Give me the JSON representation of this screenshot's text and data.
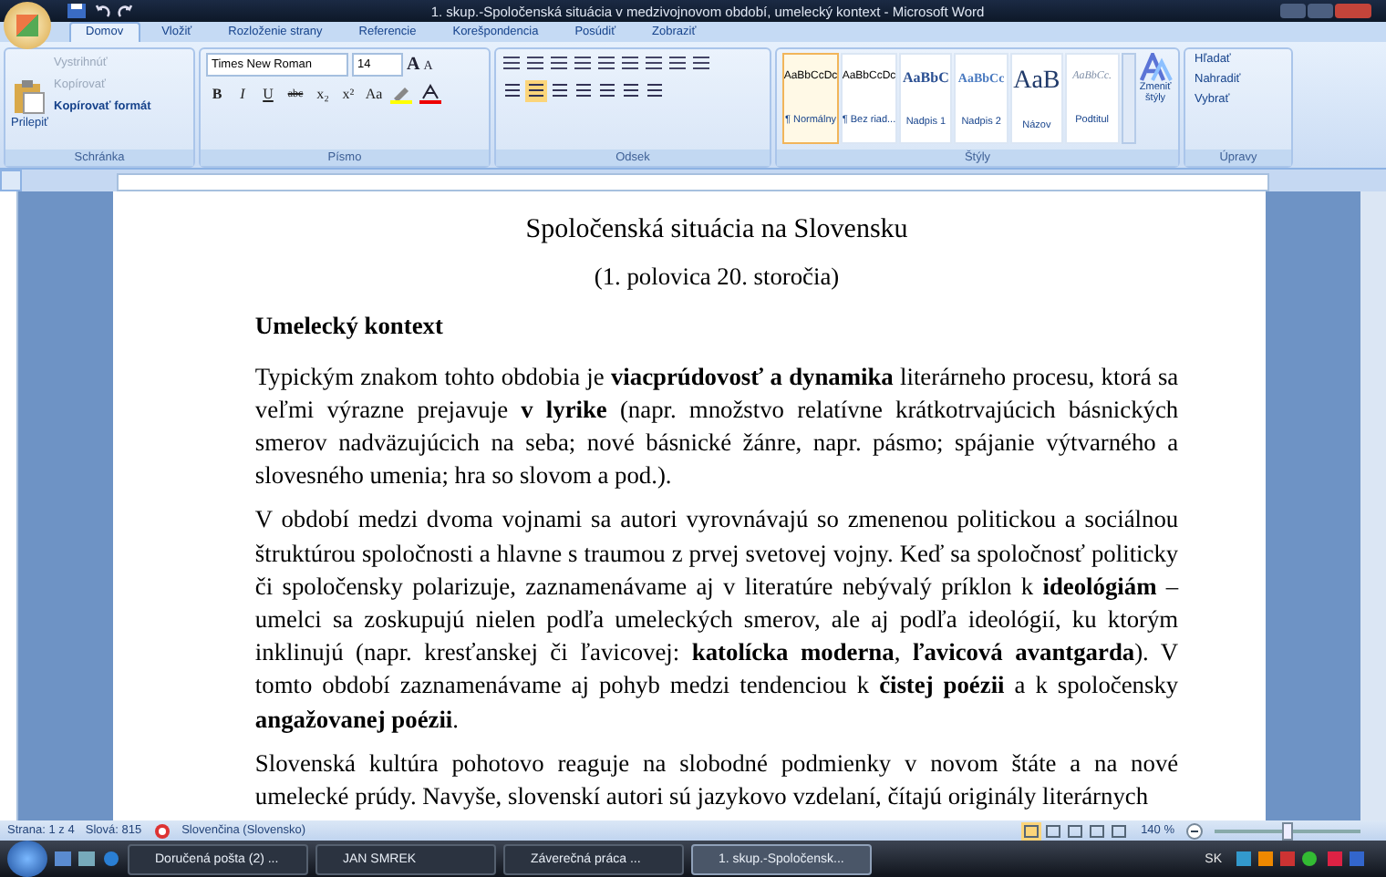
{
  "window": {
    "title": "1. skup.-Spoločenská situácia v medzivojnovom období, umelecký kontext - Microsoft Word"
  },
  "tabs": [
    {
      "label": "Domov",
      "selected": true
    },
    {
      "label": "Vložiť",
      "selected": false
    },
    {
      "label": "Rozloženie strany",
      "selected": false
    },
    {
      "label": "Referencie",
      "selected": false
    },
    {
      "label": "Korešpondencia",
      "selected": false
    },
    {
      "label": "Posúdiť",
      "selected": false
    },
    {
      "label": "Zobraziť",
      "selected": false
    }
  ],
  "clipboard": {
    "paste": "Prilepiť",
    "items": [
      {
        "label": "Vystrihnúť",
        "disabled": true
      },
      {
        "label": "Kopírovať",
        "disabled": true
      },
      {
        "label": "Kopírovať formát",
        "disabled": false
      }
    ],
    "group": "Schránka"
  },
  "font": {
    "name": "Times New Roman",
    "size": "14",
    "grow_buttons": [
      "A",
      "A"
    ],
    "format_buttons": [
      "B",
      "I",
      "U",
      "abc",
      "x₂",
      "x²",
      "Aa"
    ],
    "group": "Písmo"
  },
  "paragraph": {
    "group": "Odsek"
  },
  "styles": {
    "items": [
      {
        "sample": "AaBbCcDc",
        "name": "¶ Normálny",
        "selected": true
      },
      {
        "sample": "AaBbCcDc",
        "name": "¶ Bez riad...",
        "selected": false
      },
      {
        "sample": "AaBbC",
        "name": "Nadpis 1",
        "selected": false
      },
      {
        "sample": "AaBbCc",
        "name": "Nadpis 2",
        "selected": false
      },
      {
        "sample": "AaB",
        "name": "Názov",
        "selected": false
      },
      {
        "sample": "AaBbCc.",
        "name": "Podtitul",
        "selected": false
      }
    ],
    "change": "Zmeniť štýly",
    "group": "Štýly"
  },
  "editing": {
    "items": [
      "Hľadať",
      "Nahradiť",
      "Vybrať"
    ],
    "group": "Úpravy"
  },
  "document": {
    "title": "Spoločenská situácia na Slovensku",
    "subtitle": "(1. polovica 20. storočia)",
    "heading": "Umelecký kontext",
    "paragraphs": [
      "Typickým znakom tohto obdobia je **viacprúdovosť a dynamika** literárneho procesu, ktorá sa veľmi výrazne prejavuje **v lyrike** (napr. množstvo relatívne krátkotrvajúcich básnických smerov nadväzujúcich na seba; nové básnické žánre, napr. pásmo; spájanie výtvarného a slovesného umenia; hra so slovom a pod.).",
      "V období medzi dvoma vojnami sa autori vyrovnávajú so zmenenou politickou a sociálnou štruktúrou spoločnosti a hlavne s traumou z prvej svetovej vojny. Keď sa spoločnosť politicky či spoločensky polarizuje, zaznamenávame aj v literatúre nebývalý príklon k **ideológiám** – umelci sa zoskupujú nielen podľa umeleckých smerov, ale aj podľa ideológií, ku ktorým inklinujú (napr. kresťanskej či ľavicovej: **katolícka moderna**, **ľavicová avantgarda**). V tomto období zaznamenávame aj pohyb medzi tendenciou k **čistej poézii** a k spoločensky **angažovanej poézii**.",
      "Slovenská kultúra pohotovo reaguje na slobodné podmienky v novom štáte a na nové umelecké prúdy. Navyše, slovenskí autori sú jazykovo vzdelaní, čítajú originály literárnych"
    ]
  },
  "status_bar": {
    "page": "Strana: 1 z 4",
    "words": "Slová: 815",
    "language": "Slovenčina (Slovensko)",
    "zoom": "140 %",
    "zoom_slider": {
      "level": 0.5
    }
  },
  "taskbar": {
    "items": [
      {
        "label": "Doručená pošta (2) ...",
        "selected": false
      },
      {
        "label": "JAN SMREK",
        "selected": false
      },
      {
        "label": "Záverečná práca ...",
        "selected": false
      },
      {
        "label": "1. skup.-Spoločensk...",
        "selected": true
      }
    ],
    "lang": "SK"
  }
}
